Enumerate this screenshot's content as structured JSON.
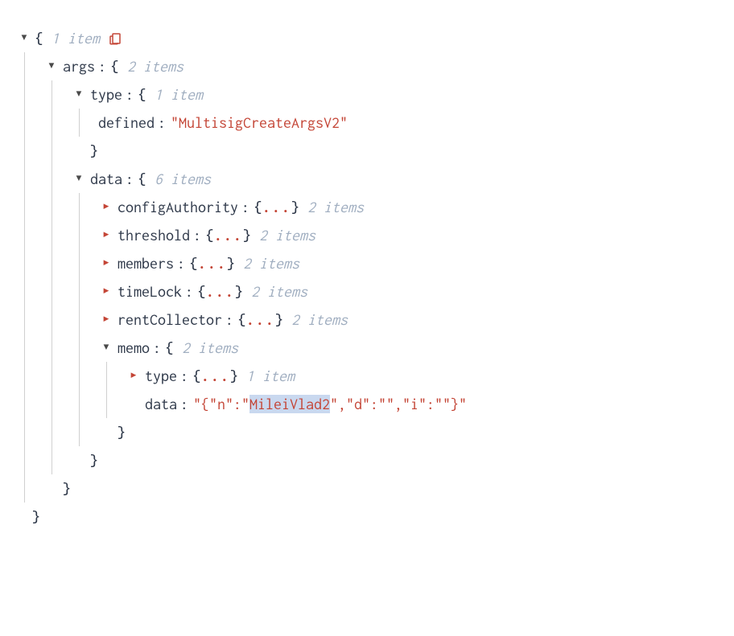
{
  "root": {
    "meta": "1 item"
  },
  "args": {
    "key": "args",
    "meta": "2 items"
  },
  "type": {
    "key": "type",
    "meta": "1 item"
  },
  "defined": {
    "key": "defined",
    "value": "\"MultisigCreateArgsV2\""
  },
  "data": {
    "key": "data",
    "meta": "6 items"
  },
  "configAuthority": {
    "key": "configAuthority",
    "meta": "2 items"
  },
  "threshold": {
    "key": "threshold",
    "meta": "2 items"
  },
  "members": {
    "key": "members",
    "meta": "2 items"
  },
  "timeLock": {
    "key": "timeLock",
    "meta": "2 items"
  },
  "rentCollector": {
    "key": "rentCollector",
    "meta": "2 items"
  },
  "memo": {
    "key": "memo",
    "meta": "2 items"
  },
  "memoType": {
    "key": "type",
    "meta": "1 item"
  },
  "memoData": {
    "key": "data",
    "prefix": "\"{\"n\":\"",
    "highlight": "MileiVlad2",
    "suffix": "\",\"d\":\"\",\"i\":\"\"}\""
  },
  "punct": {
    "colon": ":",
    "openBrace": "{",
    "closeBrace": "}",
    "ellipsis": "...",
    "collapsedOpen": "{",
    "collapsedClose": "}"
  }
}
